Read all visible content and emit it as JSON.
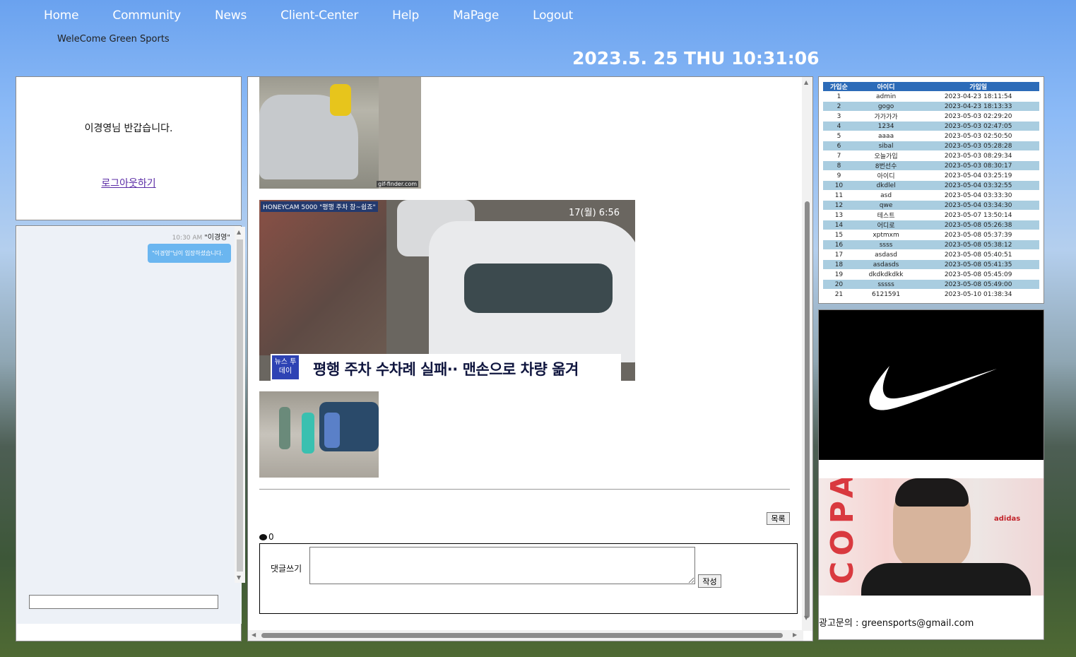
{
  "nav": {
    "items": [
      "Home",
      "Community",
      "News",
      "Client-Center",
      "Help",
      "MaPage",
      "Logout"
    ],
    "welcome": "WeleCome Green Sports",
    "clock": "2023.5. 25 THU 10:31:06"
  },
  "login": {
    "greeting": "이경영님 반갑습니다.",
    "logout_link": "로그아웃하기"
  },
  "chat": {
    "time": "10:30 AM",
    "user": "\"이경영\"",
    "message": "\"이경영\"님이 입장하셨습니다.",
    "input_value": ""
  },
  "content": {
    "image1_caption": "gif-finder.com",
    "image2_tag": "HONEYCAM 5000 \"평행 주차 참~쉽죠\"",
    "image2_time": "17(월) 6:56",
    "image2_logo": "뉴스 투데이",
    "image2_headline": "평행 주차 수차례 실패·· 맨손으로 차량 옮겨",
    "list_button": "목록",
    "comment_count": "0",
    "comment_label": "댓글쓰기",
    "comment_value": "",
    "write_button": "작성"
  },
  "members": {
    "headers": [
      "가입순",
      "아이디",
      "가입일"
    ],
    "rows": [
      [
        "1",
        "admin",
        "2023-04-23 18:11:54"
      ],
      [
        "2",
        "gogo",
        "2023-04-23 18:13:33"
      ],
      [
        "3",
        "가가가가",
        "2023-05-03 02:29:20"
      ],
      [
        "4",
        "1234",
        "2023-05-03 02:47:05"
      ],
      [
        "5",
        "aaaa",
        "2023-05-03 02:50:50"
      ],
      [
        "6",
        "sibal",
        "2023-05-03 05:28:28"
      ],
      [
        "7",
        "오늘가입",
        "2023-05-03 08:29:34"
      ],
      [
        "8",
        "8번선수",
        "2023-05-03 08:30:17"
      ],
      [
        "9",
        "아이디",
        "2023-05-04 03:25:19"
      ],
      [
        "10",
        "dkdlel",
        "2023-05-04 03:32:55"
      ],
      [
        "11",
        "asd",
        "2023-05-04 03:33:30"
      ],
      [
        "12",
        "qwe",
        "2023-05-04 03:34:30"
      ],
      [
        "13",
        "테스트",
        "2023-05-07 13:50:14"
      ],
      [
        "14",
        "어디로",
        "2023-05-08 05:26:38"
      ],
      [
        "15",
        "xptmxm",
        "2023-05-08 05:37:39"
      ],
      [
        "16",
        "ssss",
        "2023-05-08 05:38:12"
      ],
      [
        "17",
        "asdasd",
        "2023-05-08 05:40:51"
      ],
      [
        "18",
        "asdasds",
        "2023-05-08 05:41:35"
      ],
      [
        "19",
        "dkdkdkdkk",
        "2023-05-08 05:45:09"
      ],
      [
        "20",
        "sssss",
        "2023-05-08 05:49:00"
      ],
      [
        "21",
        "6121591",
        "2023-05-10 01:38:34"
      ]
    ]
  },
  "ads": {
    "adidas_copa": "COPA",
    "adidas_brand": "adidas",
    "contact": "광고문의 : greensports@gmail.com"
  },
  "colors": {
    "table_header": "#2c6bb8",
    "table_alt_row": "#a9cde0",
    "chat_bubble": "#6bb6f0"
  }
}
